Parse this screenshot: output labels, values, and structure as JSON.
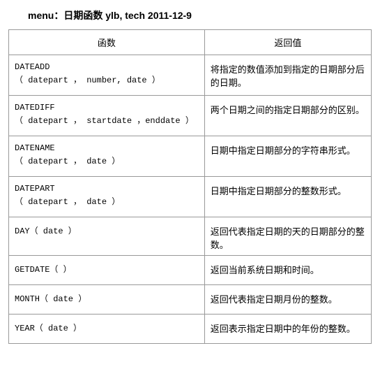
{
  "title": "menu：日期函数    ylb, tech 2011-12-9",
  "columns": {
    "func": "函数",
    "ret": "返回值"
  },
  "rows": [
    {
      "name": "DATEADD",
      "sig": "（ datepart ， number, date ）",
      "desc": "将指定的数值添加到指定的日期部分后的日期。"
    },
    {
      "name": "DATEDIFF",
      "sig": "（  datepart  ，  startdate  ，enddate ）",
      "desc": "两个日期之间的指定日期部分的区别。"
    },
    {
      "name": "DATENAME",
      "sig": "（ datepart ， date ）",
      "desc": "日期中指定日期部分的字符串形式。"
    },
    {
      "name": "DATEPART",
      "sig": "（ datepart ， date ）",
      "desc": "日期中指定日期部分的整数形式。"
    },
    {
      "name": "DAY",
      "sig": "DAY（ date ）",
      "desc": "返回代表指定日期的天的日期部分的整数。"
    },
    {
      "name": "GETDATE",
      "sig": "GETDATE（ ）",
      "desc": "返回当前系统日期和时间。"
    },
    {
      "name": "MONTH",
      "sig": "MONTH（ date ）",
      "desc": "返回代表指定日期月份的整数。"
    },
    {
      "name": "YEAR",
      "sig": "YEAR（ date ）",
      "desc": "返回表示指定日期中的年份的整数。"
    }
  ]
}
